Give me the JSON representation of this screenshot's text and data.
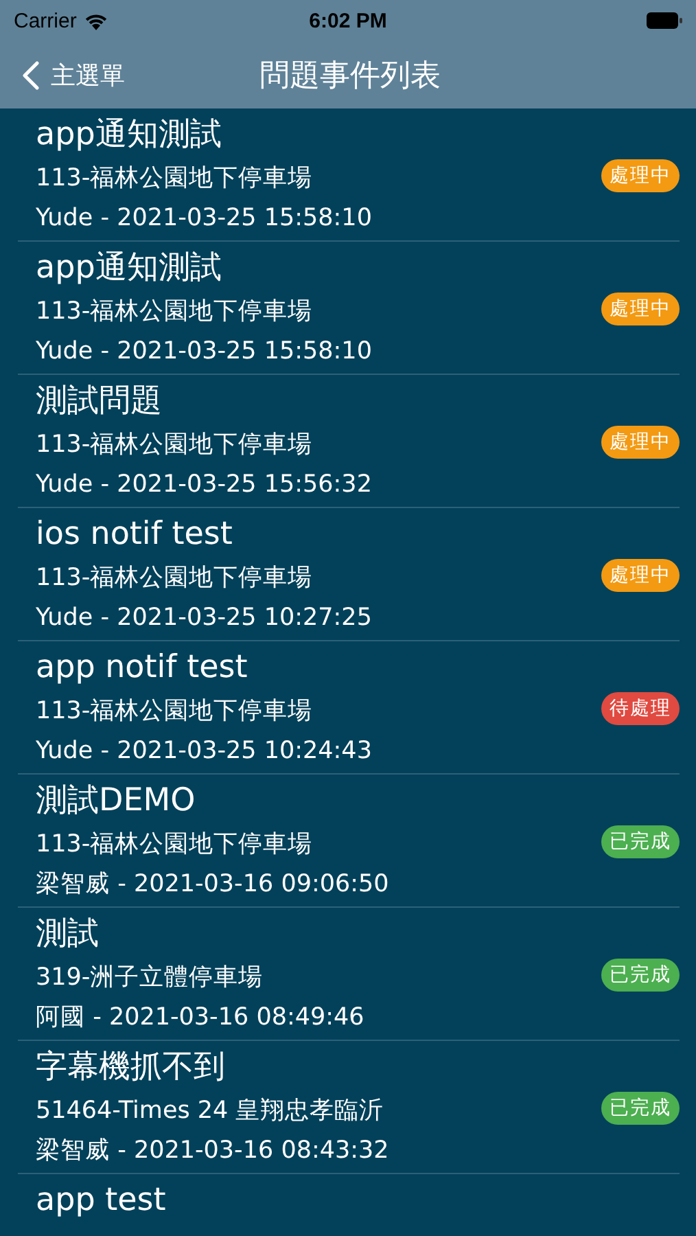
{
  "status_bar": {
    "carrier": "Carrier",
    "time": "6:02 PM"
  },
  "nav": {
    "back": "主選單",
    "title": "問題事件列表"
  },
  "events": [
    {
      "title": "app通知測試",
      "location": "113-福林公園地下停車場",
      "meta": "Yude - 2021-03-25 15:58:10",
      "status": "處理中",
      "color": "#f39a12"
    },
    {
      "title": "app通知測試",
      "location": "113-福林公園地下停車場",
      "meta": "Yude - 2021-03-25 15:58:10",
      "status": "處理中",
      "color": "#f39a12"
    },
    {
      "title": "測試問題",
      "location": "113-福林公園地下停車場",
      "meta": "Yude - 2021-03-25 15:56:32",
      "status": "處理中",
      "color": "#f39a12"
    },
    {
      "title": "ios notif test",
      "location": "113-福林公園地下停車場",
      "meta": "Yude - 2021-03-25 10:27:25",
      "status": "處理中",
      "color": "#f39a12"
    },
    {
      "title": "app notif test",
      "location": "113-福林公園地下停車場",
      "meta": "Yude - 2021-03-25 10:24:43",
      "status": "待處理",
      "color": "#e04a40"
    },
    {
      "title": "測試DEMO",
      "location": "113-福林公園地下停車場",
      "meta": "梁智威 - 2021-03-16 09:06:50",
      "status": "已完成",
      "color": "#4caf50"
    },
    {
      "title": "測試",
      "location": "319-洲子立體停車場",
      "meta": "阿國 - 2021-03-16 08:49:46",
      "status": "已完成",
      "color": "#4caf50"
    },
    {
      "title": "字幕機抓不到",
      "location": "51464-Times 24 皇翔忠孝臨沂",
      "meta": "梁智威 - 2021-03-16 08:43:32",
      "status": "已完成",
      "color": "#4caf50"
    },
    {
      "title": "app test"
    }
  ]
}
